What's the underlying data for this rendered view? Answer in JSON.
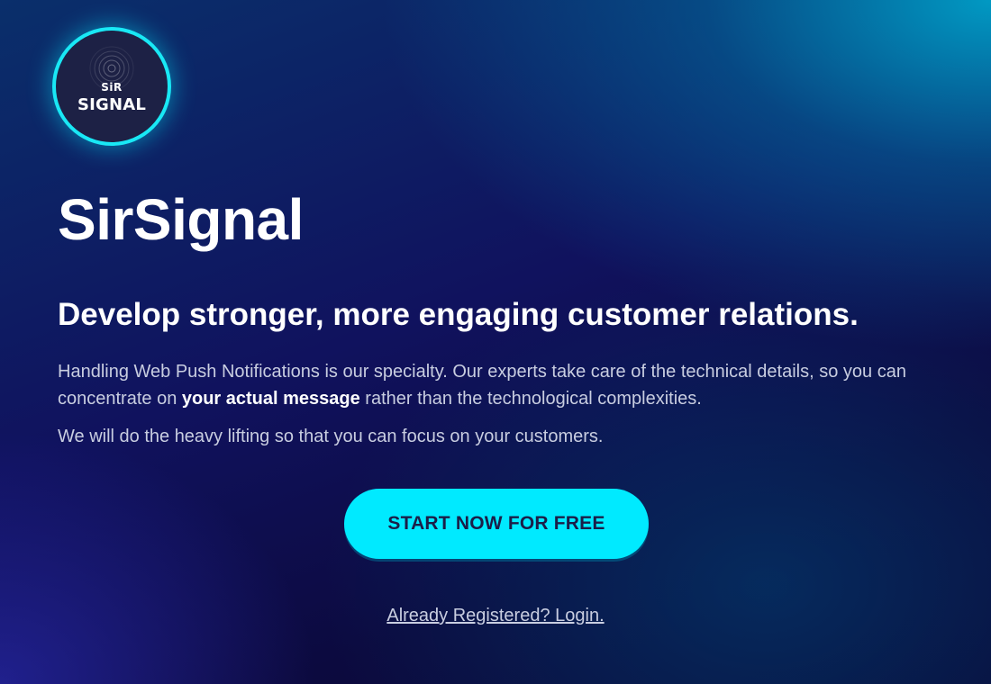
{
  "logo": {
    "top_text": "SiR",
    "bottom_text": "SIGNAL",
    "accent_color": "#19e8f5",
    "icon": "signal-waves-icon"
  },
  "hero": {
    "title": "SirSignal",
    "headline": "Develop stronger, more engaging customer relations.",
    "paragraph1": {
      "before": "Handling Web Push Notifications is our specialty. Our experts take care of the technical details, so you can concentrate on ",
      "emphasis": "your actual message",
      "after": " rather than the technological complexities."
    },
    "paragraph2": "We will do the heavy lifting so that you can focus on your customers."
  },
  "cta": {
    "label": "START NOW FOR FREE",
    "color": "#00eaff"
  },
  "login": {
    "label": "Already Registered? Login."
  }
}
